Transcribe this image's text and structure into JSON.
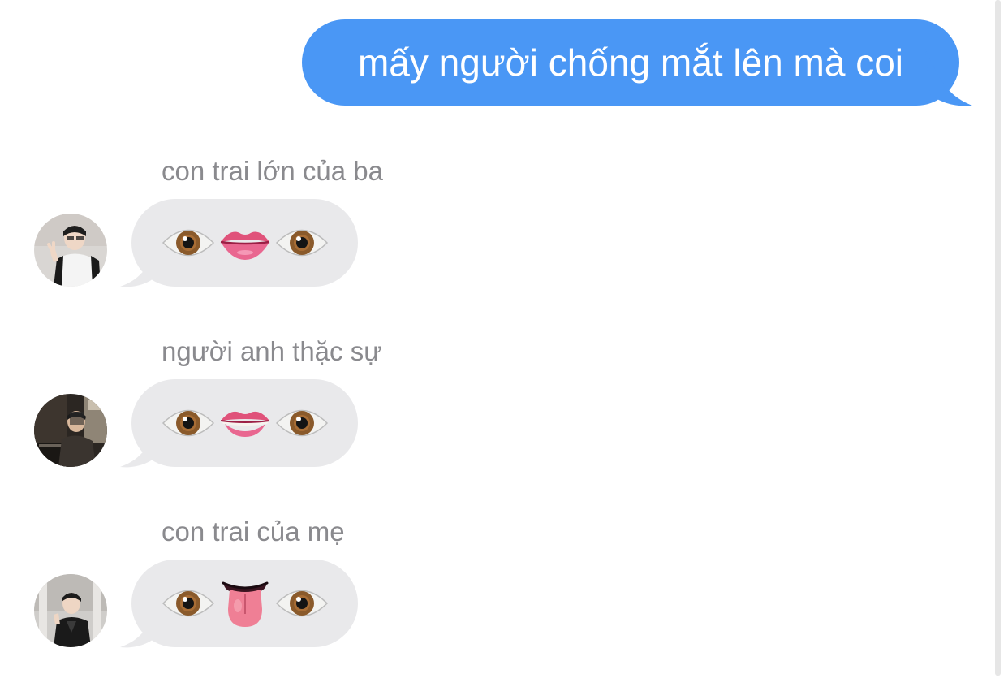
{
  "outgoing": {
    "text": "mấy người chống mắt lên mà coi",
    "bubble_color": "#4a97f5"
  },
  "messages": [
    {
      "sender": "con trai lớn của ba",
      "emojis": [
        "eye-icon",
        "mouth-icon",
        "eye-icon"
      ]
    },
    {
      "sender": "người anh thặc sự",
      "emojis": [
        "eye-icon",
        "biting-lip-icon",
        "eye-icon"
      ]
    },
    {
      "sender": "con trai của mẹ",
      "emojis": [
        "eye-icon",
        "tongue-icon",
        "eye-icon"
      ]
    }
  ],
  "colors": {
    "incoming_bubble": "#e9e9eb",
    "sender_name": "#8a8a8e"
  }
}
